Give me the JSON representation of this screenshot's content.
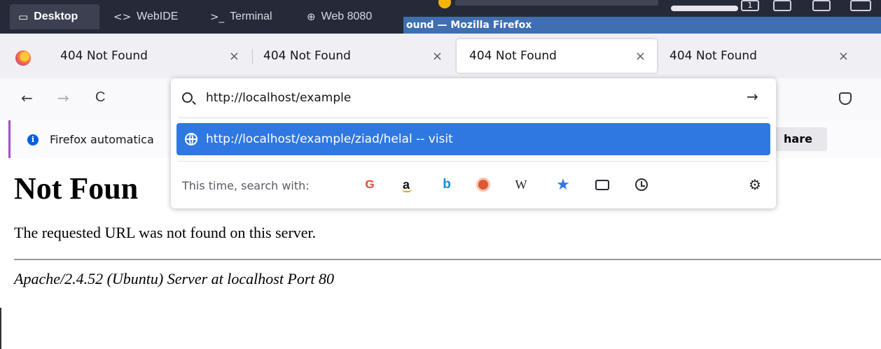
{
  "lab_tabs": [
    {
      "icon": "desktop-icon",
      "glyph": "▭",
      "label": "Desktop"
    },
    {
      "icon": "code-icon",
      "glyph": "<>",
      "label": "WebIDE"
    },
    {
      "icon": "terminal-icon",
      "glyph": ">_",
      "label": "Terminal"
    },
    {
      "icon": "globe-icon",
      "glyph": "⊕",
      "label": "Web 8080"
    }
  ],
  "window_title": "ound — Mozilla Firefox",
  "lab_status_count": "1",
  "browser_tabs": [
    {
      "label": "404 Not Found",
      "close": "×"
    },
    {
      "label": "404 Not Found",
      "close": "×"
    },
    {
      "label": "404 Not Found",
      "close": "×"
    },
    {
      "label": "404 Not Found",
      "close": "×"
    }
  ],
  "nav": {
    "back": "←",
    "forward": "→",
    "reload": "C"
  },
  "urlbar": {
    "value": "http://localhost/example",
    "go_icon": "→",
    "suggestion": "http://localhost/example/ziad/helal -- visit",
    "search_with_label": "This time, search with:",
    "engines": [
      "G",
      "a",
      "b",
      "",
      "W",
      "★",
      "",
      ""
    ],
    "settings_glyph": "⚙"
  },
  "notification": {
    "text": "Firefox automatica",
    "button": "hare"
  },
  "page": {
    "heading": "Not Foun",
    "message": "The requested URL was not found on this server.",
    "server": "Apache/2.4.52 (Ubuntu) Server at localhost Port 80"
  },
  "colors": {
    "accent": "#2f78e2",
    "titlebar": "#3f6fb0",
    "labbar": "#262a38"
  }
}
